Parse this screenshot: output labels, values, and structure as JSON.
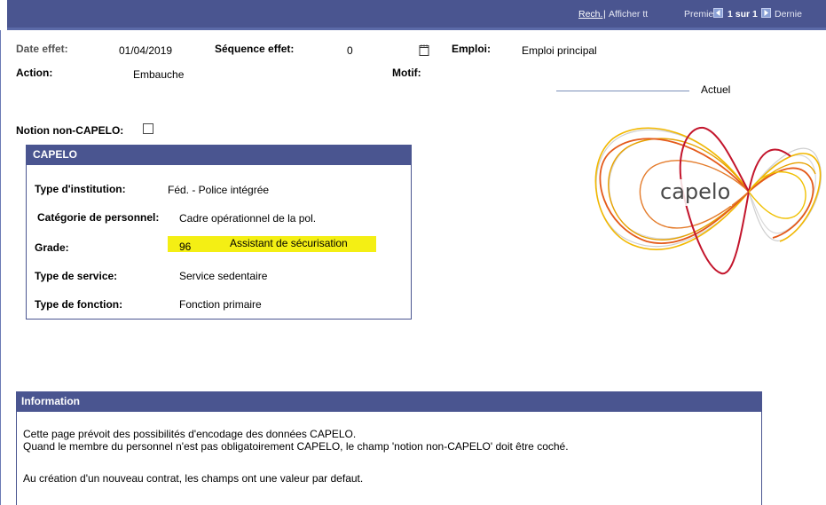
{
  "nav": {
    "search": "Rech.",
    "separator": "|",
    "show_all": "Afficher tt",
    "first": "Premier",
    "page_info": "1 sur 1",
    "last": "Dernie"
  },
  "header": {
    "date_effet_label": "Date effet:",
    "date_effet_value": "01/04/2019",
    "sequence_label": "Séquence effet:",
    "sequence_value": "0",
    "emploi_label": "Emploi:",
    "emploi_value": "Emploi principal",
    "action_label": "Action:",
    "action_value": "Embauche",
    "motif_label": "Motif:",
    "status": "Actuel"
  },
  "non_capelo": {
    "label": "Notion non-CAPELO:",
    "checked": false
  },
  "capelo": {
    "title": "CAPELO",
    "type_institution_label": "Type d'institution:",
    "type_institution_value": "Féd. - Police intégrée",
    "categorie_label": "Catégorie de personnel:",
    "categorie_value": "Cadre opérationnel de la pol.",
    "grade_label": "Grade:",
    "grade_code": "96",
    "grade_desc": "Assistant de sécurisation",
    "type_service_label": "Type de service:",
    "type_service_value": "Service sedentaire",
    "type_fonction_label": "Type de fonction:",
    "type_fonction_value": "Fonction primaire"
  },
  "logo": {
    "text": "capelo"
  },
  "information": {
    "title": "Information",
    "line1": "Cette page prévoit des possibilités d'encodage des données CAPELO.",
    "line2": "Quand le membre du personnel n'est pas obligatoirement CAPELO, le champ 'notion non-CAPELO' doit être coché.",
    "line3": "Au création d'un nouveau contrat, les champs ont une valeur par defaut."
  },
  "colors": {
    "header_blue": "#4a5590",
    "highlight_yellow": "#f4ef14"
  }
}
